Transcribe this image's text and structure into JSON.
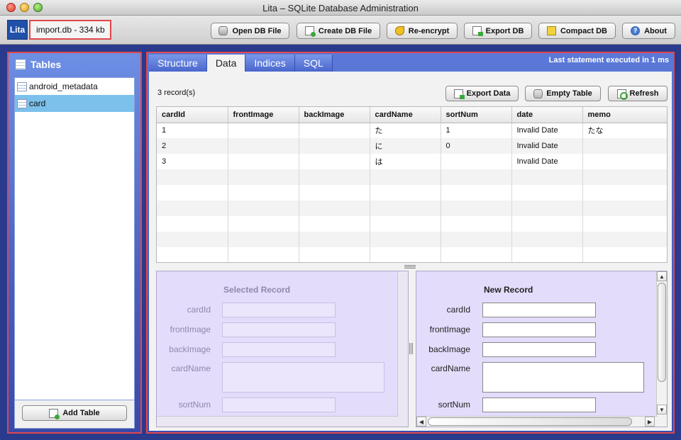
{
  "window": {
    "title": "Lita – SQLite Database Administration"
  },
  "app": {
    "logo_text": "Lita",
    "db_info": "import.db - 334 kb"
  },
  "toolbar": {
    "open_db": "Open DB File",
    "create_db": "Create DB File",
    "reencrypt": "Re-encrypt",
    "export_db": "Export DB",
    "compact_db": "Compact DB",
    "about": "About"
  },
  "sidebar": {
    "header": "Tables",
    "items": [
      {
        "label": "android_metadata"
      },
      {
        "label": "card"
      }
    ],
    "add_table": "Add Table"
  },
  "tabs": [
    {
      "label": "Structure"
    },
    {
      "label": "Data"
    },
    {
      "label": "Indices"
    },
    {
      "label": "SQL"
    }
  ],
  "status": {
    "last_statement": "Last statement executed in 1 ms"
  },
  "data_view": {
    "record_count": "3 record(s)",
    "export_data": "Export Data",
    "empty_table": "Empty Table",
    "refresh": "Refresh",
    "columns": [
      "cardId",
      "frontImage",
      "backImage",
      "cardName",
      "sortNum",
      "date",
      "memo"
    ],
    "rows": [
      [
        "1",
        "",
        "",
        "た",
        "1",
        "Invalid Date",
        "たな"
      ],
      [
        "2",
        "",
        "",
        "に",
        "0",
        "Invalid Date",
        ""
      ],
      [
        "3",
        "",
        "",
        "は",
        "",
        "Invalid Date",
        ""
      ]
    ]
  },
  "selected_record": {
    "title": "Selected Record",
    "fields": [
      {
        "label": "cardId"
      },
      {
        "label": "frontImage"
      },
      {
        "label": "backImage"
      },
      {
        "label": "cardName"
      },
      {
        "label": "sortNum"
      }
    ]
  },
  "new_record": {
    "title": "New Record",
    "fields": [
      {
        "label": "cardId"
      },
      {
        "label": "frontImage"
      },
      {
        "label": "backImage"
      },
      {
        "label": "cardName"
      },
      {
        "label": "sortNum"
      }
    ]
  }
}
